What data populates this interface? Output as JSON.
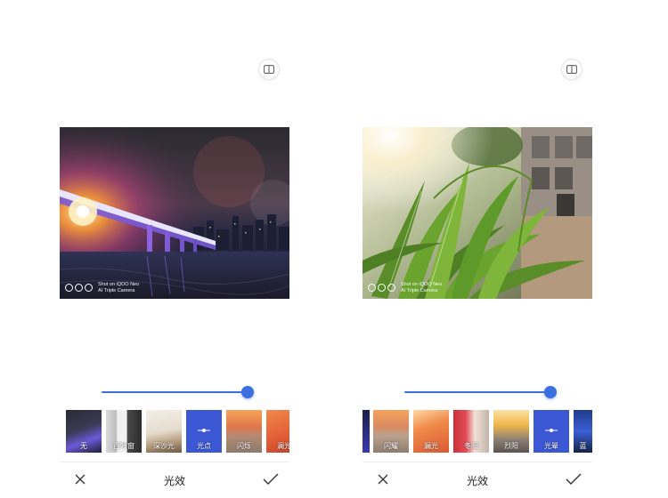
{
  "screens": [
    {
      "id": "left",
      "watermark": {
        "line1": "Shot on iQOO Neo",
        "line2": "AI Triple Camera"
      },
      "filters": [
        {
          "label": "无",
          "theme": "night-bridge"
        },
        {
          "label": "百叶窗",
          "theme": "window"
        },
        {
          "label": "深沙光",
          "theme": "room"
        },
        {
          "label": "光点",
          "theme": "selected",
          "selected": true
        },
        {
          "label": "闪烁",
          "theme": "building-warm"
        },
        {
          "label": "澜光",
          "theme": "orange"
        }
      ],
      "toolbar": {
        "title": "光效",
        "close_icon": "close-icon",
        "confirm_icon": "check-icon"
      }
    },
    {
      "id": "right",
      "watermark": {
        "line1": "Shot on iQOO Neo",
        "line2": "AI Triple Camera"
      },
      "filters": [
        {
          "label": "",
          "theme": "dark-blue"
        },
        {
          "label": "闪耀",
          "theme": "building-warm"
        },
        {
          "label": "漏光",
          "theme": "orange"
        },
        {
          "label": "冬阳",
          "theme": "portrait"
        },
        {
          "label": "烈阳",
          "theme": "city-sun"
        },
        {
          "label": "光晕",
          "theme": "selected",
          "selected": true
        },
        {
          "label": "蓝",
          "theme": "blue-night"
        }
      ],
      "toolbar": {
        "title": "光效",
        "close_icon": "close-icon",
        "confirm_icon": "check-icon"
      }
    }
  ],
  "slider": {
    "value": 1.0
  },
  "colors": {
    "accent": "#3b6fe0",
    "selected_tile": "#3b57d4"
  }
}
